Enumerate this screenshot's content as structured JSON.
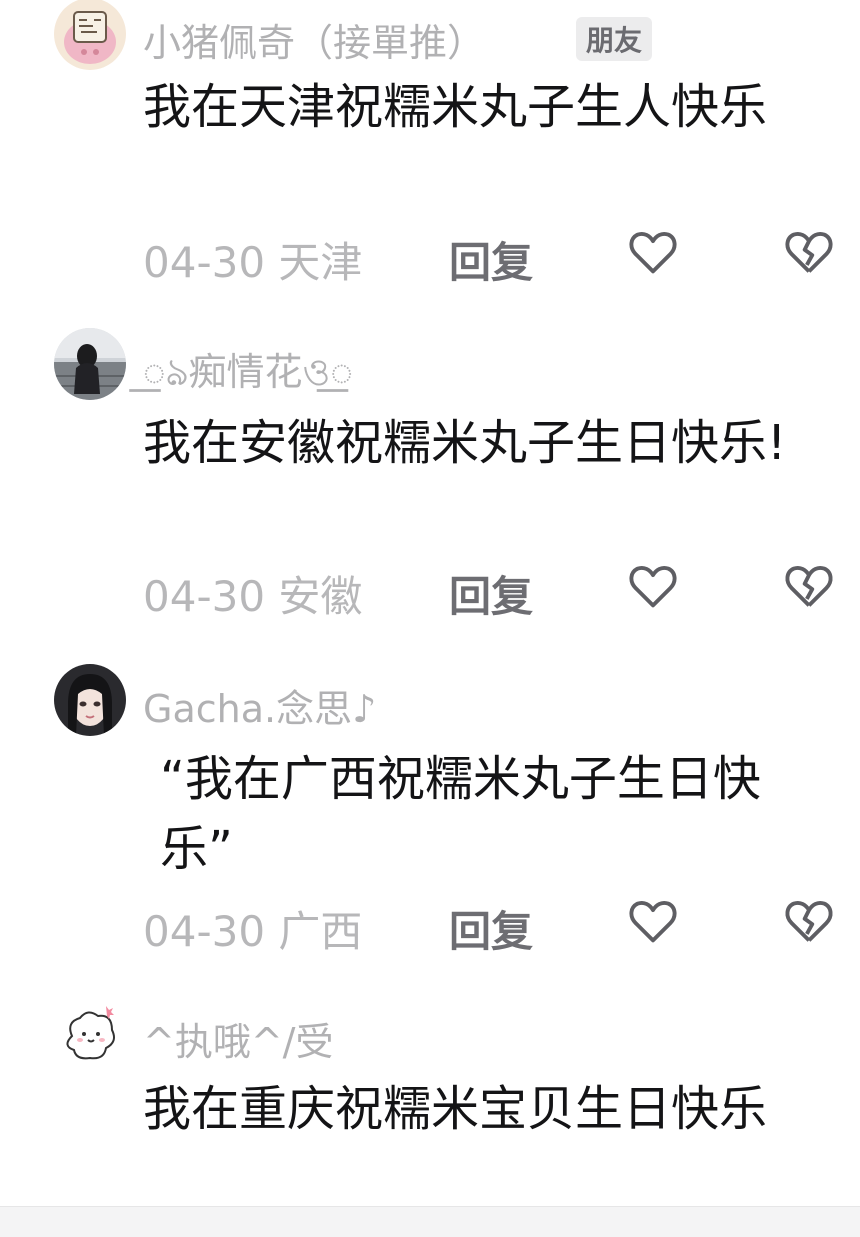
{
  "colors": {
    "username": "#b1b1b3",
    "content": "#141416",
    "meta": "#b7b7b9",
    "reply": "#6d6d72",
    "icon": "#5e5e63"
  },
  "comments": [
    {
      "username": "小猪佩奇（接單推）",
      "badge": "朋友",
      "content": "我在天津祝糯米丸子生人快乐",
      "date": "04-30",
      "location": "天津",
      "reply_label": "回复",
      "avatar_icon": "cartoon-pig-avatar"
    },
    {
      "username": "꯭ঌ痴情花ও꯭",
      "content": "我在安徽祝糯米丸子生日快乐!",
      "date": "04-30",
      "location": "安徽",
      "reply_label": "回复",
      "avatar_icon": "girl-by-window-avatar"
    },
    {
      "username": "Gacha.念思♪",
      "content": "“我在广西祝糯米丸子生日快乐”",
      "date": "04-30",
      "location": "广西",
      "reply_label": "回复",
      "avatar_icon": "anime-girl-avatar"
    },
    {
      "username": "^执哦^/受",
      "content": "我在重庆祝糯米宝贝生日快乐",
      "avatar_icon": "doodle-dog-avatar"
    }
  ]
}
